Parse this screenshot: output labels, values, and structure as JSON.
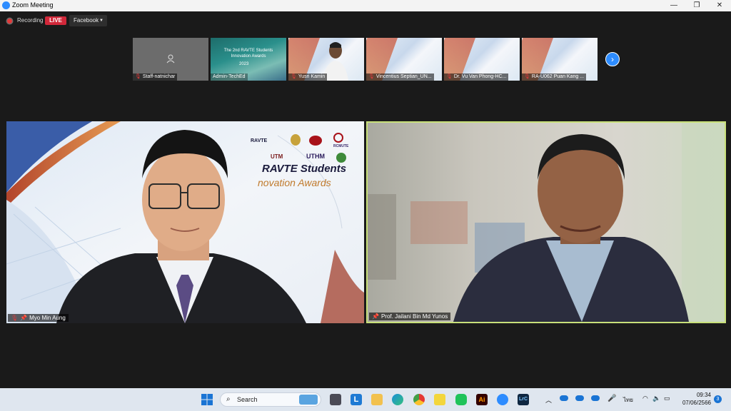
{
  "window": {
    "title": "Zoom Meeting",
    "minimize": "—",
    "restore": "❐",
    "close": "✕"
  },
  "toolbar": {
    "recording_label": "Recording",
    "live_label": "LIVE",
    "stream_target": "Facebook",
    "stream_caret": "▼"
  },
  "thumbnails": [
    {
      "name": "Staff-natnichar",
      "muted": true
    },
    {
      "name": "Admin-TechEd",
      "muted": false
    },
    {
      "name": "Yusri Kamin",
      "muted": true
    },
    {
      "name": "Vincentius Septian_UN...",
      "muted": true
    },
    {
      "name": "Dr. Vu Van Phong-HC...",
      "muted": true
    },
    {
      "name": "RA-U062 Puan Kang ...",
      "muted": true
    }
  ],
  "slide_texts": {
    "thumb_title": "The 2nd RAVTE Students Innovation Awards",
    "thumb_year": "2023",
    "main_title": "RAVTE Students",
    "main_subtitle": "novation Awards",
    "logos": [
      "RAVTE",
      "UTM",
      "UTHM",
      "RCMUTE"
    ]
  },
  "next_button": "›",
  "main": {
    "left_name": "Myo Min Aung",
    "right_name": "Prof. Jailani Bin Md Yunos"
  },
  "taskbar": {
    "search_label": "Search",
    "lang": "ไทย",
    "time": "09:34",
    "date": "07/06/2566",
    "notif_count": "3"
  },
  "colors": {
    "zoom_blue": "#2d8cff",
    "live_red": "#d1283a",
    "active_border": "#c8e07a"
  }
}
